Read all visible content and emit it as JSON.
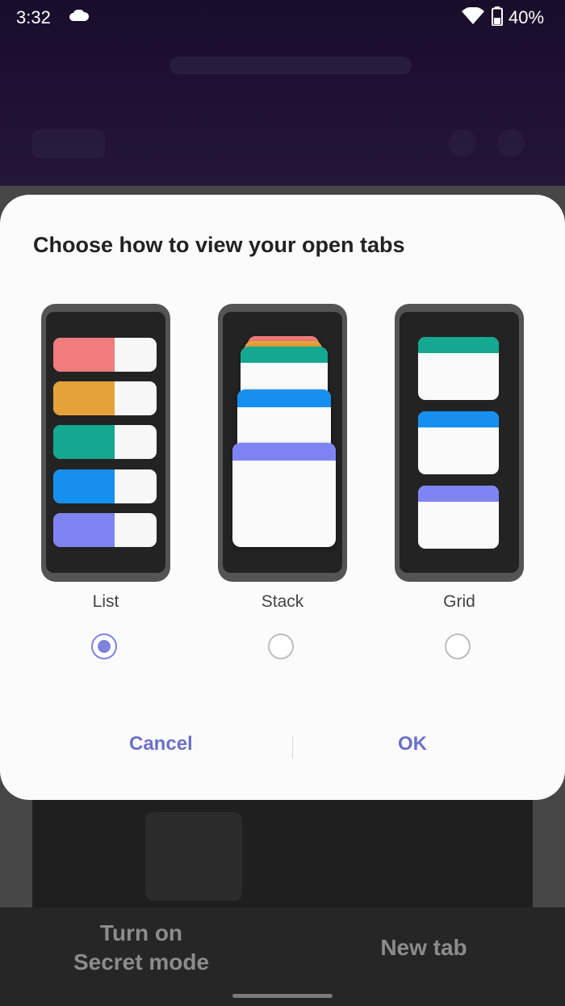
{
  "status_bar": {
    "time": "3:32",
    "battery": "40%"
  },
  "dialog": {
    "title": "Choose how to view your open tabs",
    "options": [
      {
        "label": "List",
        "selected": true
      },
      {
        "label": "Stack",
        "selected": false
      },
      {
        "label": "Grid",
        "selected": false
      }
    ],
    "cancel": "Cancel",
    "ok": "OK"
  },
  "bottom_bar": {
    "secret_mode": "Turn on\nSecret mode",
    "new_tab": "New tab"
  },
  "colors": {
    "accent": "#7f84db",
    "button_text": "#6b71c6",
    "tab_colors": [
      "#f07c7c",
      "#e5a23a",
      "#13a88f",
      "#1690f0",
      "#7f84f5"
    ]
  },
  "icons": [
    "cloud-icon",
    "wifi-icon",
    "battery-icon"
  ]
}
